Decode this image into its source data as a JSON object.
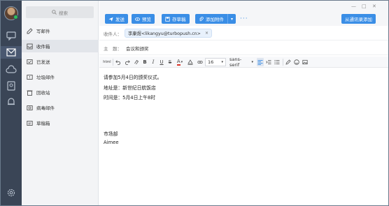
{
  "rail": {
    "icons": [
      "chat-icon",
      "mail-icon",
      "cloud-icon",
      "contacts-icon",
      "bell-icon",
      "settings-icon"
    ]
  },
  "sidebar": {
    "search_placeholder": "搜索",
    "folders": [
      {
        "label": "写邮件",
        "icon": "compose-icon"
      },
      {
        "label": "收件箱",
        "icon": "inbox-icon"
      },
      {
        "label": "已发送",
        "icon": "sent-icon"
      },
      {
        "label": "垃圾邮件",
        "icon": "spam-icon"
      },
      {
        "label": "回收站",
        "icon": "trash-icon"
      },
      {
        "label": "病毒邮件",
        "icon": "virus-icon"
      },
      {
        "label": "草稿箱",
        "icon": "draft-icon"
      }
    ]
  },
  "toolbar": {
    "send_label": "发送",
    "preview_label": "预览",
    "save_draft_label": "存草稿",
    "attach_label": "添加附件",
    "more_label": "···",
    "add_from_contacts_label": "从通讯录添加"
  },
  "compose": {
    "to_label": "收件人：",
    "recipient": "李康煜<likangyu@turbopush.cn>",
    "remove_glyph": "×",
    "subject_label": "主　题：",
    "subject_value": "会议和颁奖",
    "font_size": "16",
    "font_family": "sans-serif",
    "body": {
      "line1": "请参加5月4日的颁奖仪式。",
      "line2": "地址是：新世纪日航饭店",
      "line3": "时间是：5月4日上午8时",
      "line4": "市场部",
      "line5": "Aimee"
    }
  },
  "colors": {
    "rail": "#3a4556",
    "accent": "#3a8ee6",
    "sidebar": "#f3f4f6"
  }
}
